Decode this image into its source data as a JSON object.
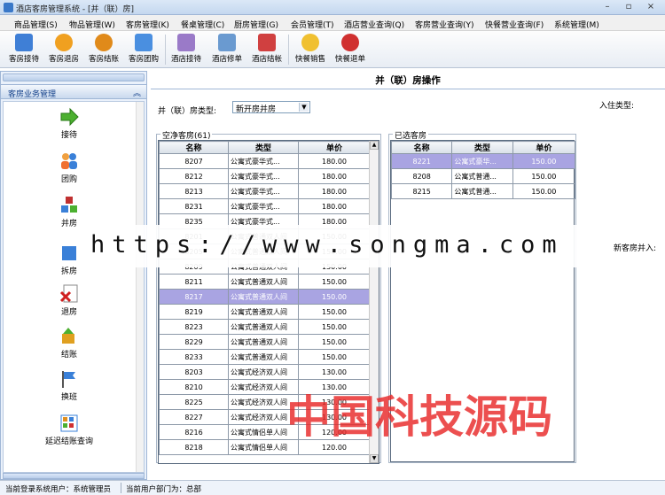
{
  "window": {
    "title": "酒店客房管理系统 - [并（联）房]"
  },
  "menu": [
    "商品管理(S)",
    "物品管理(W)",
    "客房管理(K)",
    "餐桌管理(C)",
    "厨房管理(G)",
    "会员管理(T)",
    "酒店营业查询(Q)",
    "客房营业查询(Y)",
    "快餐营业查询(F)",
    "系统管理(M)"
  ],
  "toolbar": [
    {
      "label": "客房接待",
      "icon": "room-reception-icon",
      "color": "#3f7fd6"
    },
    {
      "label": "客房退房",
      "icon": "room-checkout-icon",
      "color": "#f0a020"
    },
    {
      "label": "客房结账",
      "icon": "room-settle-icon",
      "color": "#e08a1a"
    },
    {
      "label": "客房团购",
      "icon": "room-group-icon",
      "color": "#4a8fe0"
    },
    {
      "label": "酒店接待",
      "icon": "hotel-reception-icon",
      "color": "#9a7ac8"
    },
    {
      "label": "酒店修单",
      "icon": "hotel-edit-icon",
      "color": "#6a9ad0"
    },
    {
      "label": "酒店结帐",
      "icon": "hotel-settle-icon",
      "color": "#d04040"
    },
    {
      "label": "快餐销售",
      "icon": "fastfood-sale-icon",
      "color": "#f0c030"
    },
    {
      "label": "快餐退单",
      "icon": "fastfood-refund-icon",
      "color": "#d03030"
    }
  ],
  "sidebar": {
    "title": "客房业务管理",
    "items": [
      {
        "label": "接待",
        "icon": "arrow-right-icon",
        "color": "#4cb030"
      },
      {
        "label": "团购",
        "icon": "people-icon",
        "color": "#3a80d8"
      },
      {
        "label": "并房",
        "icon": "cubes-icon",
        "color": "#c03030"
      },
      {
        "label": "拆房",
        "icon": "split-icon",
        "color": "#3a80d8"
      },
      {
        "label": "退房",
        "icon": "delete-doc-icon",
        "color": "#d02020"
      },
      {
        "label": "结账",
        "icon": "settle-icon",
        "color": "#e0a020"
      },
      {
        "label": "换班",
        "icon": "flag-icon",
        "color": "#3a80d8"
      },
      {
        "label": "延迟结账查询",
        "icon": "grid-icon",
        "color": "#e09020"
      }
    ]
  },
  "main": {
    "title": "并（联）房操作",
    "room_type_label": "并（联）房类型:",
    "room_type_value": "新开房并房",
    "checkin_type_label": "入住类型:",
    "new_room_label": "新客房并入:",
    "available": {
      "title": "空净客房(61)",
      "headers": [
        "名称",
        "类型",
        "单价"
      ],
      "rows": [
        [
          "8207",
          "公寓式豪华式...",
          "180.00"
        ],
        [
          "8212",
          "公寓式豪华式...",
          "180.00"
        ],
        [
          "8213",
          "公寓式豪华式...",
          "180.00"
        ],
        [
          "8231",
          "公寓式豪华式...",
          "180.00"
        ],
        [
          "8235",
          "公寓式豪华式...",
          "180.00"
        ],
        [
          "8201",
          "公寓式普通双人间",
          "150.00"
        ],
        [
          "8205",
          "公寓式普通双人间",
          "150.00"
        ],
        [
          "8209",
          "公寓式普通双人间",
          "150.00"
        ],
        [
          "8211",
          "公寓式普通双人间",
          "150.00"
        ],
        [
          "8217",
          "公寓式普通双人间",
          "150.00"
        ],
        [
          "8219",
          "公寓式普通双人间",
          "150.00"
        ],
        [
          "8223",
          "公寓式普通双人间",
          "150.00"
        ],
        [
          "8229",
          "公寓式普通双人间",
          "150.00"
        ],
        [
          "8233",
          "公寓式普通双人间",
          "150.00"
        ],
        [
          "8203",
          "公寓式经济双人间",
          "130.00"
        ],
        [
          "8210",
          "公寓式经济双人间",
          "130.00"
        ],
        [
          "8225",
          "公寓式经济双人间",
          "130.00"
        ],
        [
          "8227",
          "公寓式经济双人间",
          "130.00"
        ],
        [
          "8216",
          "公寓式情侣单人间",
          "120.00"
        ],
        [
          "8218",
          "公寓式情侣单人间",
          "120.00"
        ]
      ],
      "selected_row": 9
    },
    "selected": {
      "title": "已选客房",
      "headers": [
        "名称",
        "类型",
        "单价"
      ],
      "rows": [
        [
          "8221",
          "公寓式豪华...",
          "150.00"
        ],
        [
          "8208",
          "公寓式普通...",
          "150.00"
        ],
        [
          "8215",
          "公寓式普通...",
          "150.00"
        ]
      ],
      "selected_row": 0
    }
  },
  "watermark": {
    "url": "https://www.songma.com",
    "brand": "中国科技源码"
  },
  "status": {
    "user": "当前登录系统用户：系统管理员",
    "dept": "当前用户部门为：总部"
  }
}
